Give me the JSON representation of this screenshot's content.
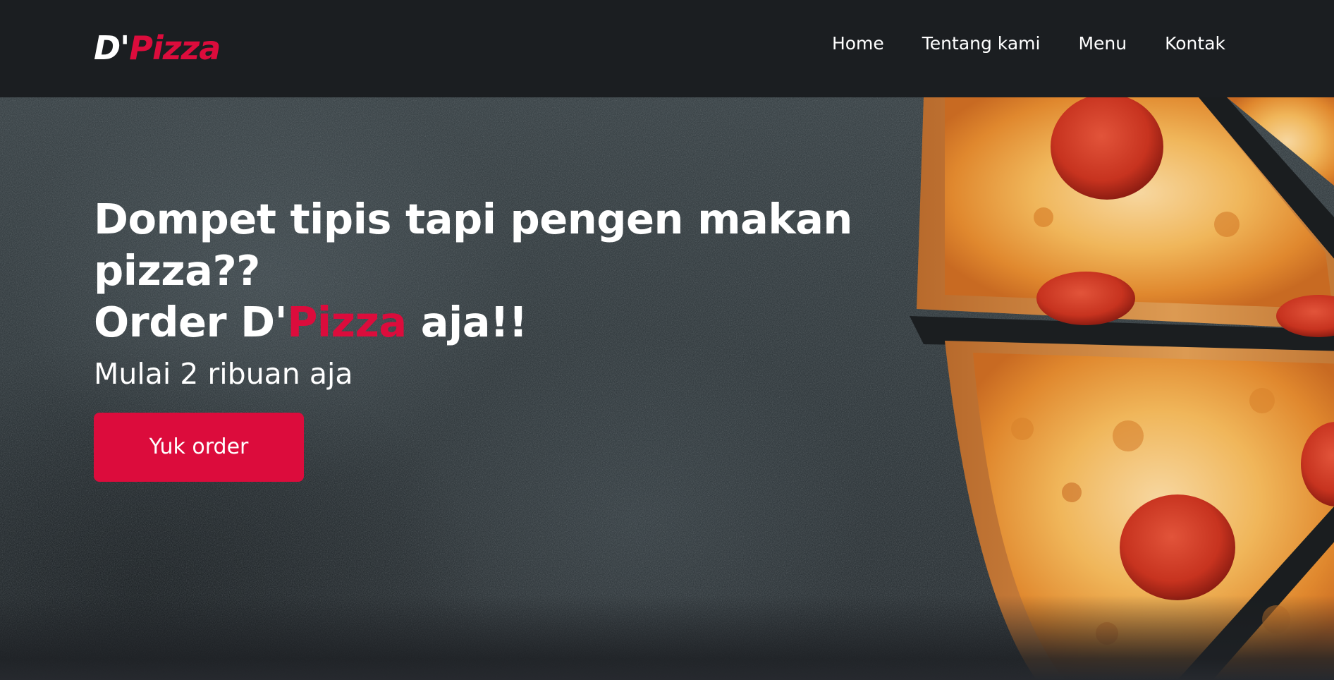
{
  "brand": {
    "prefix": "D'",
    "highlight": "Pizza"
  },
  "nav": {
    "items": [
      {
        "label": "Home"
      },
      {
        "label": "Tentang kami"
      },
      {
        "label": "Menu"
      },
      {
        "label": "Kontak"
      }
    ]
  },
  "hero": {
    "headline_line1": "Dompet tipis tapi pengen makan",
    "headline_line2": "pizza??",
    "headline_line3_prefix": "Order D'",
    "headline_line3_highlight": "Pizza",
    "headline_line3_suffix": " aja!!",
    "subtitle": "Mulai 2 ribuan aja",
    "cta_label": "Yuk order"
  },
  "colors": {
    "accent": "#dc0c3c",
    "navbar_background": "#1b1e21",
    "text": "#ffffff"
  },
  "icons": {
    "hero_image": "pizza-image"
  }
}
